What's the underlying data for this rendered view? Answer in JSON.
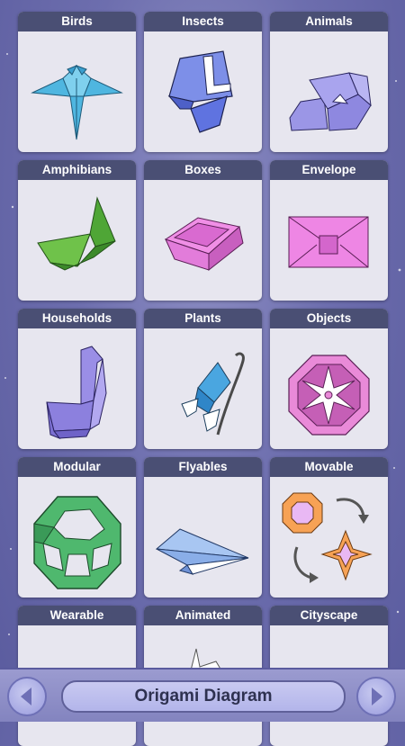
{
  "categories": [
    {
      "label": "Birds"
    },
    {
      "label": "Insects"
    },
    {
      "label": "Animals"
    },
    {
      "label": "Amphibians"
    },
    {
      "label": "Boxes"
    },
    {
      "label": "Envelope"
    },
    {
      "label": "Households"
    },
    {
      "label": "Plants"
    },
    {
      "label": "Objects"
    },
    {
      "label": "Modular"
    },
    {
      "label": "Flyables"
    },
    {
      "label": "Movable"
    },
    {
      "label": "Wearable"
    },
    {
      "label": "Animated"
    },
    {
      "label": "Cityscape"
    }
  ],
  "bottom_bar": {
    "title": "Origami Diagram",
    "prev_icon": "arrow-left-icon",
    "next_icon": "arrow-right-icon"
  },
  "colors": {
    "header": "#4a4f74",
    "card": "#e7e6ef",
    "background": "#6d6eae"
  }
}
